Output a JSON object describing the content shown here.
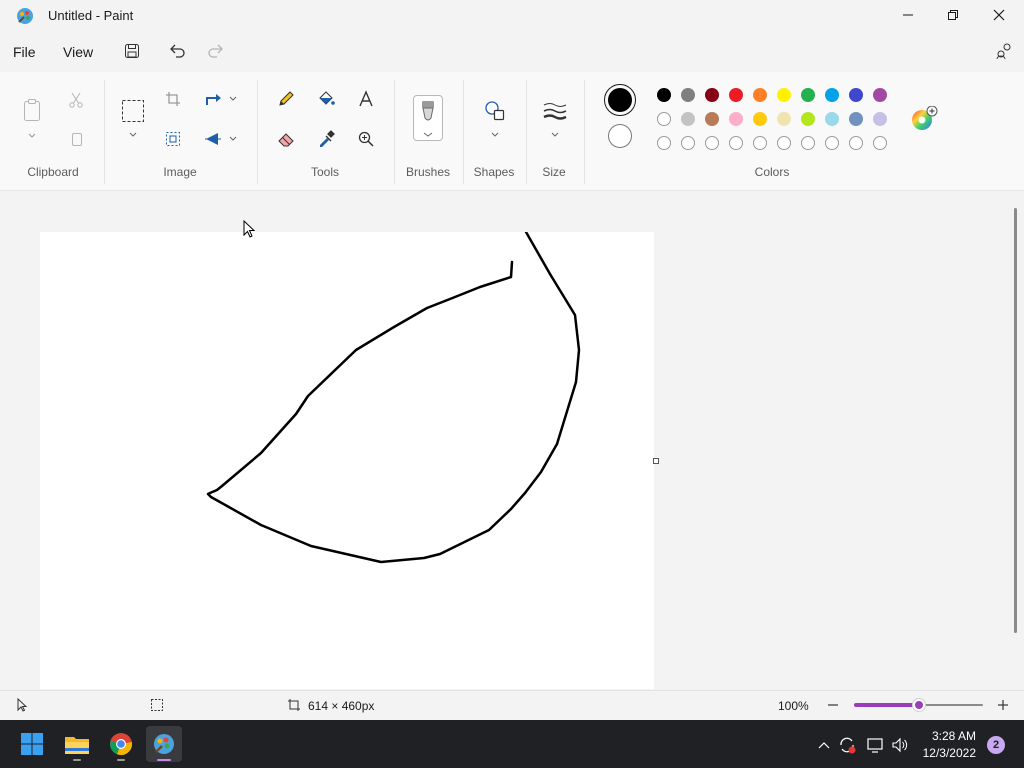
{
  "window": {
    "title": "Untitled - Paint"
  },
  "menu": {
    "file": "File",
    "view": "View"
  },
  "ribbon": {
    "groups": {
      "clipboard": "Clipboard",
      "image": "Image",
      "tools": "Tools",
      "brushes": "Brushes",
      "shapes": "Shapes",
      "size": "Size",
      "colors": "Colors"
    },
    "colors": {
      "primary": "#000000",
      "secondary": "#ffffff",
      "palette_row1": [
        "#000000",
        "#7f7f7f",
        "#880015",
        "#ed1c24",
        "#ff7f27",
        "#fff200",
        "#22b14c",
        "#00a2e8",
        "#3f48cc",
        "#a349a4"
      ],
      "palette_row2": [
        "#ffffff",
        "#c3c3c3",
        "#b97a57",
        "#ffaec9",
        "#ffc90e",
        "#efe4b0",
        "#b5e61d",
        "#99d9ea",
        "#7092be",
        "#c8bfe7"
      ],
      "palette_row3": [
        "#ffffff",
        "#ffffff",
        "#ffffff",
        "#ffffff",
        "#ffffff",
        "#ffffff",
        "#ffffff",
        "#ffffff",
        "#ffffff",
        "#ffffff"
      ]
    }
  },
  "status": {
    "canvas_size": "614 × 460px",
    "zoom": "100%",
    "zoom_level": 0.5
  },
  "taskbar": {
    "time": "3:28 AM",
    "date": "12/3/2022",
    "notification_count": "2"
  }
}
